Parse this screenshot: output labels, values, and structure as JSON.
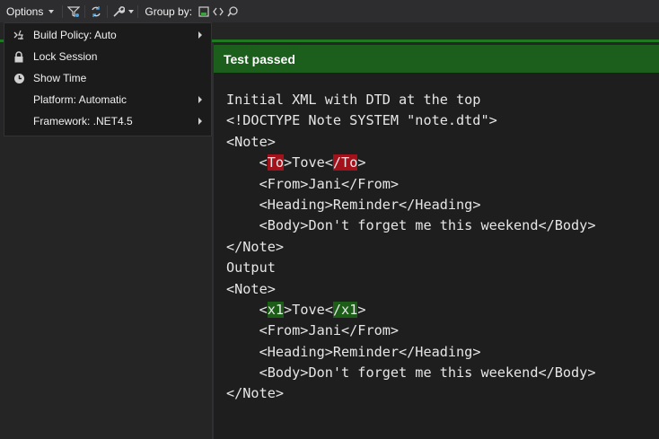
{
  "toolbar": {
    "options_label": "Options",
    "group_by_label": "Group by:",
    "icons": [
      "filter-icon",
      "sync-icon",
      "wrench-icon",
      "group-namespace-icon",
      "group-code-icon",
      "group-project-icon"
    ]
  },
  "options_menu": {
    "items": [
      {
        "label": "Build Policy: Auto",
        "icon": "build-policy-icon",
        "has_submenu": true
      },
      {
        "label": "Lock Session",
        "icon": "lock-icon",
        "has_submenu": false
      },
      {
        "label": "Show Time",
        "icon": "clock-icon",
        "has_submenu": false
      },
      {
        "label": "Platform: Automatic",
        "icon": "",
        "has_submenu": true
      },
      {
        "label": "Framework: .NET4.5",
        "icon": "",
        "has_submenu": true
      }
    ]
  },
  "test_result": {
    "status": "Test passed",
    "status_color": "#1c5e1c"
  },
  "output": {
    "line1": "Initial XML with DTD at the top",
    "line2": "<!DOCTYPE Note SYSTEM \"note.dtd\">",
    "line3": "<Note>",
    "line4_open": "To",
    "line4_text": "Tove",
    "line4_close": "/To",
    "line5": "<From>Jani</From>",
    "line6": "<Heading>Reminder</Heading>",
    "line7": "<Body>Don't forget me this weekend</Body>",
    "line8": "</Note>",
    "line9": "Output",
    "line10": "<Note>",
    "line11_open": "x1",
    "line11_text": "Tove",
    "line11_close": "/x1",
    "line12": "<From>Jani</From>",
    "line13": "<Heading>Reminder</Heading>",
    "line14": "<Body>Don't forget me this weekend</Body>",
    "line15": "</Note>",
    "removed_highlight_color": "#a3111b",
    "added_highlight_color": "#1c5d17"
  }
}
